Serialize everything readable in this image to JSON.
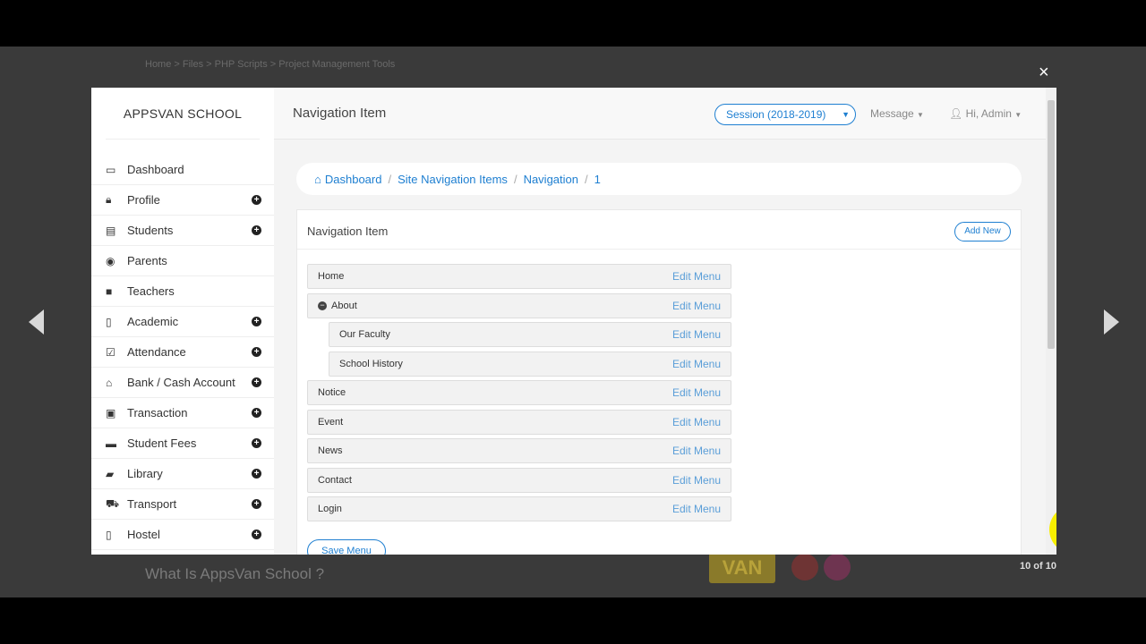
{
  "background": {
    "breadcrumb": "Home  >  Files  >  PHP Scripts  >  Project Management Tools",
    "heading": "What Is AppsVan School ?",
    "logo_text": "VAN"
  },
  "lightbox": {
    "close_glyph": "×",
    "counter": "10 of 10"
  },
  "sidebar": {
    "brand": "APPSVAN SCHOOL",
    "items": [
      {
        "label": "Dashboard",
        "icon": "monitor-icon",
        "glyph": "▭",
        "expandable": false
      },
      {
        "label": "Profile",
        "icon": "lock-icon",
        "glyph": "🔒︎",
        "expandable": true
      },
      {
        "label": "Students",
        "icon": "id-card-icon",
        "glyph": "▤",
        "expandable": true
      },
      {
        "label": "Parents",
        "icon": "user-circle-icon",
        "glyph": "◉",
        "expandable": false
      },
      {
        "label": "Teachers",
        "icon": "badge-icon",
        "glyph": "■",
        "expandable": false
      },
      {
        "label": "Academic",
        "icon": "book-icon",
        "glyph": "▯",
        "expandable": true
      },
      {
        "label": "Attendance",
        "icon": "calendar-check-icon",
        "glyph": "☑",
        "expandable": true
      },
      {
        "label": "Bank / Cash Account",
        "icon": "bank-icon",
        "glyph": "⌂",
        "expandable": true
      },
      {
        "label": "Transaction",
        "icon": "money-icon",
        "glyph": "▣",
        "expandable": true
      },
      {
        "label": "Student Fees",
        "icon": "credit-card-icon",
        "glyph": "▬",
        "expandable": true
      },
      {
        "label": "Library",
        "icon": "book-open-icon",
        "glyph": "▰",
        "expandable": true
      },
      {
        "label": "Transport",
        "icon": "car-icon",
        "glyph": "⛟",
        "expandable": true
      },
      {
        "label": "Hostel",
        "icon": "building-icon",
        "glyph": "▯",
        "expandable": true
      }
    ]
  },
  "topbar": {
    "title": "Navigation Item",
    "session": "Session (2018-2019)",
    "message": "Message",
    "admin": "Hi, Admin"
  },
  "breadcrumb": {
    "items": [
      "Dashboard",
      "Site Navigation Items",
      "Navigation",
      "1"
    ]
  },
  "panel": {
    "title": "Navigation Item",
    "add_new": "Add New",
    "save": "Save Menu",
    "edit_label": "Edit Menu",
    "menu_items": [
      {
        "label": "Home",
        "level": 0
      },
      {
        "label": "About",
        "level": 0,
        "collapsible": true
      },
      {
        "label": "Our Faculty",
        "level": 1
      },
      {
        "label": "School History",
        "level": 1
      },
      {
        "label": "Notice",
        "level": 0
      },
      {
        "label": "Event",
        "level": 0
      },
      {
        "label": "News",
        "level": 0
      },
      {
        "label": "Contact",
        "level": 0
      },
      {
        "label": "Login",
        "level": 0
      }
    ]
  },
  "colors": {
    "accent": "#1e7fd1",
    "link": "#5a9ed8",
    "cursor_highlight": "#f7ef00"
  }
}
